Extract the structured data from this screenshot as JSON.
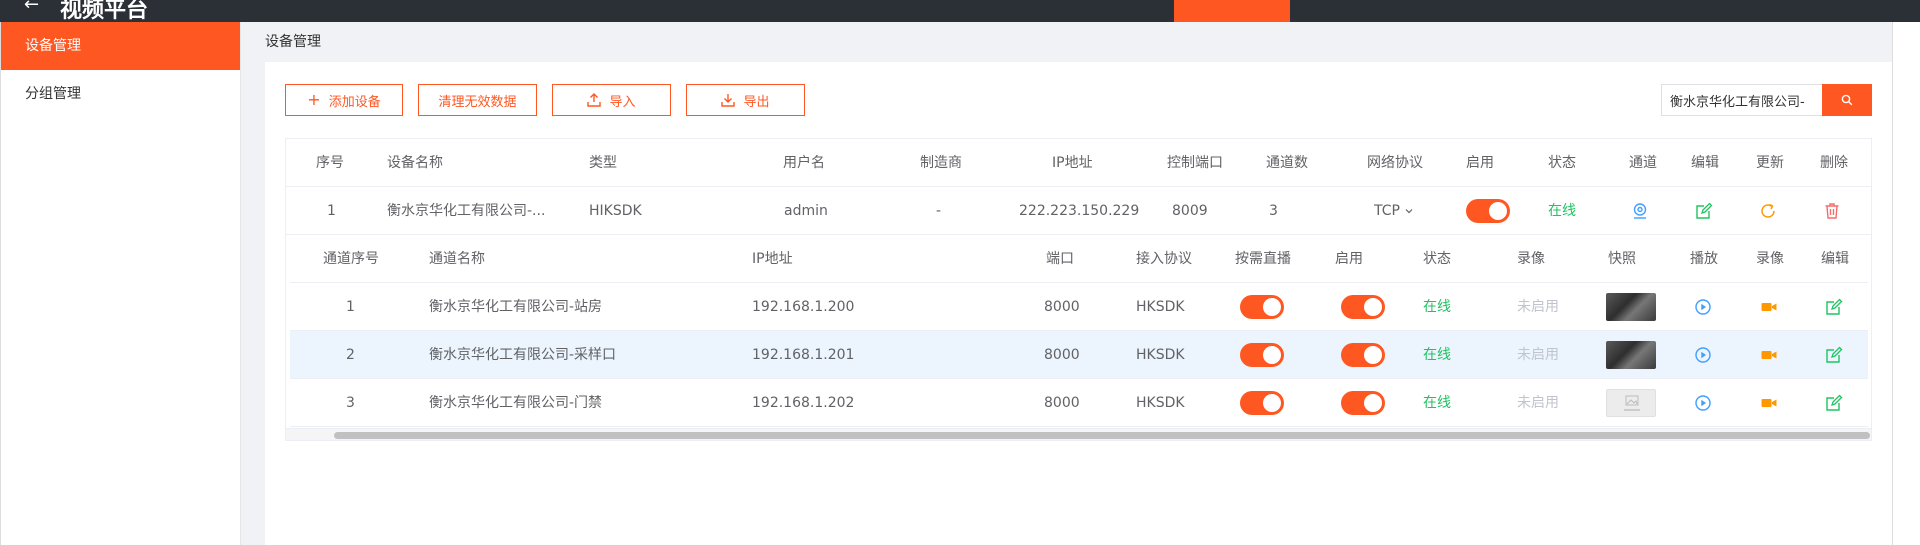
{
  "topbar": {
    "back": "←",
    "brand": "视频平台"
  },
  "sidebar": {
    "items": [
      {
        "label": "设备管理"
      },
      {
        "label": "分组管理"
      }
    ]
  },
  "breadcrumb": "设备管理",
  "toolbar": {
    "add": "添加设备",
    "clear": "清理无效数据",
    "import": "导入",
    "export": "导出"
  },
  "search": {
    "value": "衡水京华化工有限公司-"
  },
  "device_table": {
    "headers": {
      "index": "序号",
      "name": "设备名称",
      "type": "类型",
      "username": "用户名",
      "manufacturer": "制造商",
      "ip": "IP地址",
      "port": "控制端口",
      "channels": "通道数",
      "protocol": "网络协议",
      "enable": "启用",
      "status": "状态",
      "channel": "通道",
      "edit": "编辑",
      "update": "更新",
      "delete": "删除"
    },
    "row": {
      "index": "1",
      "name": "衡水京华化工有限公司-...",
      "type": "HIKSDK",
      "username": "admin",
      "manufacturer": "-",
      "ip": "222.223.150.229",
      "port": "8009",
      "channels": "3",
      "protocol": "TCP",
      "status": "在线"
    }
  },
  "channel_table": {
    "headers": {
      "index": "通道序号",
      "name": "通道名称",
      "ip": "IP地址",
      "port": "端口",
      "access": "接入协议",
      "ondemand": "按需直播",
      "enable": "启用",
      "status": "状态",
      "record": "录像",
      "snapshot": "快照",
      "play": "播放",
      "record2": "录像",
      "edit": "编辑"
    },
    "rows": [
      {
        "index": "1",
        "name": "衡水京华化工有限公司-站房",
        "ip": "192.168.1.200",
        "port": "8000",
        "access": "HKSDK",
        "status": "在线",
        "record": "未启用"
      },
      {
        "index": "2",
        "name": "衡水京华化工有限公司-采样口",
        "ip": "192.168.1.201",
        "port": "8000",
        "access": "HKSDK",
        "status": "在线",
        "record": "未启用"
      },
      {
        "index": "3",
        "name": "衡水京华化工有限公司-门禁",
        "ip": "192.168.1.202",
        "port": "8000",
        "access": "HKSDK",
        "status": "在线",
        "record": "未启用"
      }
    ]
  },
  "colors": {
    "accent": "#ff5722",
    "online": "#21c262",
    "play": "#409eff",
    "record": "#ff9800",
    "edit": "#21c262",
    "delete": "#f56c6c"
  }
}
